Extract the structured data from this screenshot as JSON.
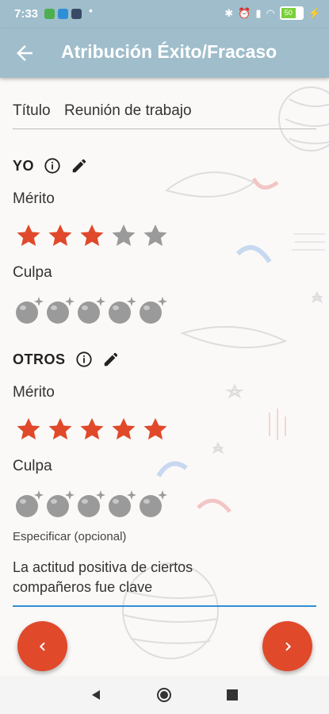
{
  "status_bar": {
    "time": "7:33",
    "battery": "50"
  },
  "app_bar": {
    "title": "Atribución Éxito/Fracaso",
    "back_icon": "arrow-left-icon"
  },
  "title_field": {
    "label": "Título",
    "value": "Reunión de trabajo"
  },
  "self": {
    "heading": "YO",
    "merit_label": "Mérito",
    "merit_rating": 3,
    "blame_label": "Culpa",
    "blame_rating": 0
  },
  "others": {
    "heading": "OTROS",
    "merit_label": "Mérito",
    "merit_rating": 5,
    "blame_label": "Culpa",
    "blame_rating": 0
  },
  "max_rating": 5,
  "specify": {
    "label": "Especificar (opcional)",
    "value": "La actitud positiva de ciertos compañeros fue clave"
  },
  "colors": {
    "accent": "#e0492a",
    "appbar": "#9fbdcb",
    "inactive": "#9a9a9a",
    "underline": "#2f8fd6"
  }
}
